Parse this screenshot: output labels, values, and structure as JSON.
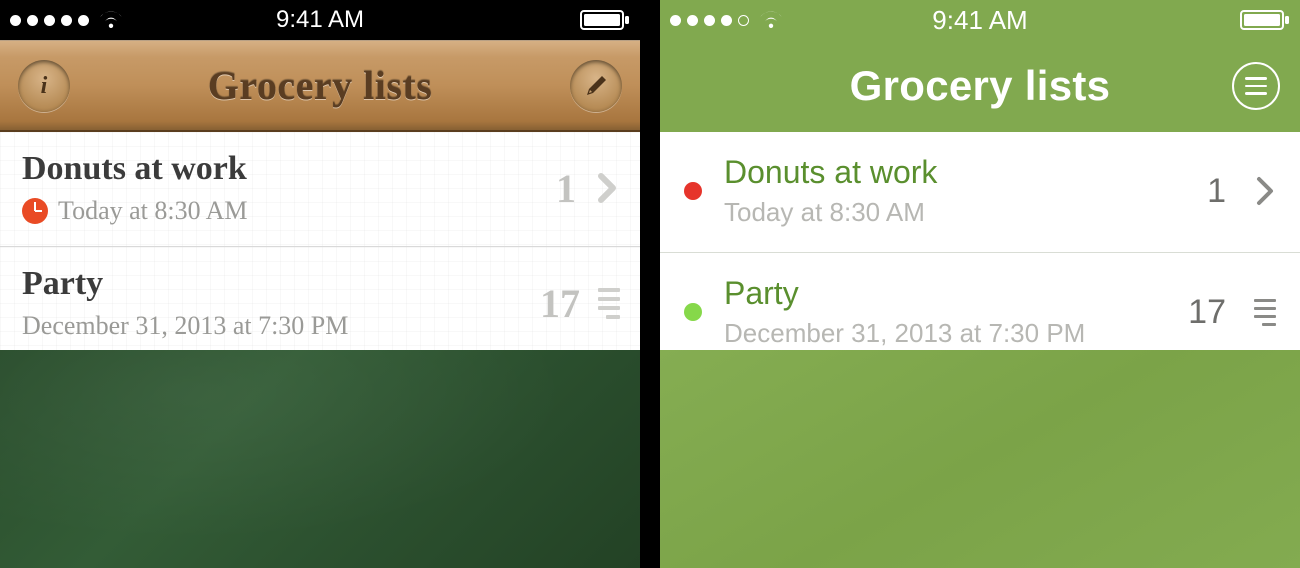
{
  "status": {
    "time": "9:41 AM"
  },
  "left": {
    "header": {
      "title": "Grocery lists"
    },
    "items": [
      {
        "title": "Donuts at work",
        "subtitle": "Today at 8:30 AM",
        "count": "1",
        "has_clock": true,
        "accessory": "chevron"
      },
      {
        "title": "Party",
        "subtitle": "December 31, 2013 at 7:30 PM",
        "count": "17",
        "has_clock": false,
        "accessory": "lines"
      }
    ]
  },
  "right": {
    "header": {
      "title": "Grocery lists"
    },
    "items": [
      {
        "title": "Donuts at work",
        "subtitle": "Today at 8:30 AM",
        "count": "1",
        "dot_color": "#e6342b",
        "accessory": "chevron"
      },
      {
        "title": "Party",
        "subtitle": "December 31, 2013 at 7:30 PM",
        "count": "17",
        "dot_color": "#86d84a",
        "accessory": "lines"
      }
    ],
    "colors": {
      "accent": "#5a8f2e",
      "header_bg": "#81a94f"
    }
  }
}
